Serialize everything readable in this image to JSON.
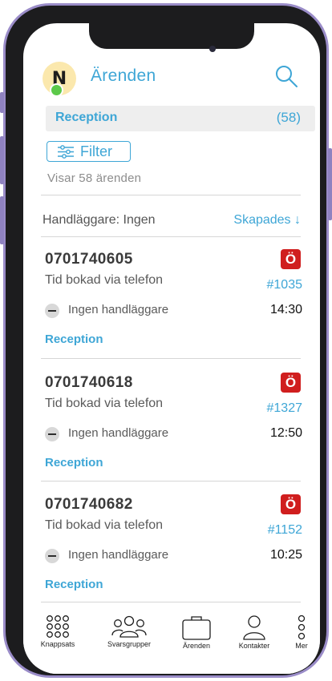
{
  "header": {
    "avatar_initial": "N",
    "title": "Ärenden"
  },
  "queue_bar": {
    "label": "Reception",
    "count": "(58)"
  },
  "filter": {
    "label": "Filter"
  },
  "summary": "Visar 58  ärenden",
  "list_header": {
    "assignee_filter": "Handläggare: Ingen",
    "sort_label": "Skapades ↓"
  },
  "tickets": [
    {
      "phone": "0701740605",
      "subject": "Tid bokad via telefon",
      "badge": "Ö",
      "ticket_id": "#1035",
      "assignee": "Ingen handläggare",
      "time": "14:30",
      "queue": "Reception"
    },
    {
      "phone": "0701740618",
      "subject": "Tid bokad via telefon",
      "badge": "Ö",
      "ticket_id": "#1327",
      "assignee": "Ingen handläggare",
      "time": "12:50",
      "queue": "Reception"
    },
    {
      "phone": "0701740682",
      "subject": "Tid bokad via telefon",
      "badge": "Ö",
      "ticket_id": "#1152",
      "assignee": "Ingen handläggare",
      "time": "10:25",
      "queue": "Reception"
    }
  ],
  "bottom_nav": [
    {
      "label": "Knappsats",
      "icon": "keypad-icon"
    },
    {
      "label": "Svarsgrupper",
      "icon": "group-icon"
    },
    {
      "label": "Ärenden",
      "icon": "briefcase-icon"
    },
    {
      "label": "Kontakter",
      "icon": "person-icon"
    },
    {
      "label": "Mer",
      "icon": "more-icon"
    }
  ],
  "colors": {
    "accent": "#3ea6d6",
    "badge": "#d01e1e",
    "online": "#5cc94a",
    "avatar_bg": "#fbe8ad",
    "frame": "#9a8cc8"
  }
}
